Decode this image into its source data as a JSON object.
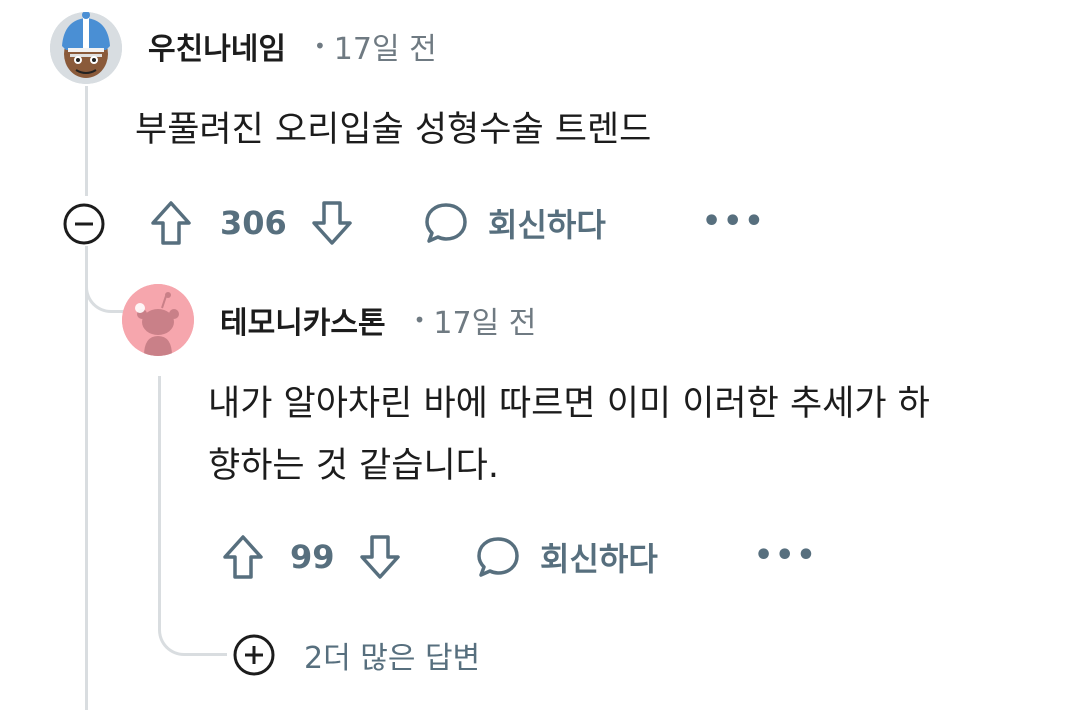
{
  "comments": [
    {
      "username": "우친나네임",
      "time": "17일 전",
      "body": "부풀려진 오리입술 성형수술 트렌드",
      "score": "306",
      "reply_label": "회신하다",
      "more_label": "•••"
    },
    {
      "username": "테모니카스톤",
      "time": "17일 전",
      "body_line1": "내가 알아차린 바에 따르면 이미 이러한 추세가 하",
      "body_line2": "향하는 것 같습니다.",
      "score": "99",
      "reply_label": "회신하다",
      "more_label": "•••"
    }
  ],
  "more_replies": {
    "label": "2더 많은 답변"
  },
  "colors": {
    "text": "#1c1c1c",
    "meta": "#6f7a82",
    "action": "#576f7e",
    "thread_line": "#d9dde0",
    "avatar2_bg": "#f6a6ad"
  }
}
